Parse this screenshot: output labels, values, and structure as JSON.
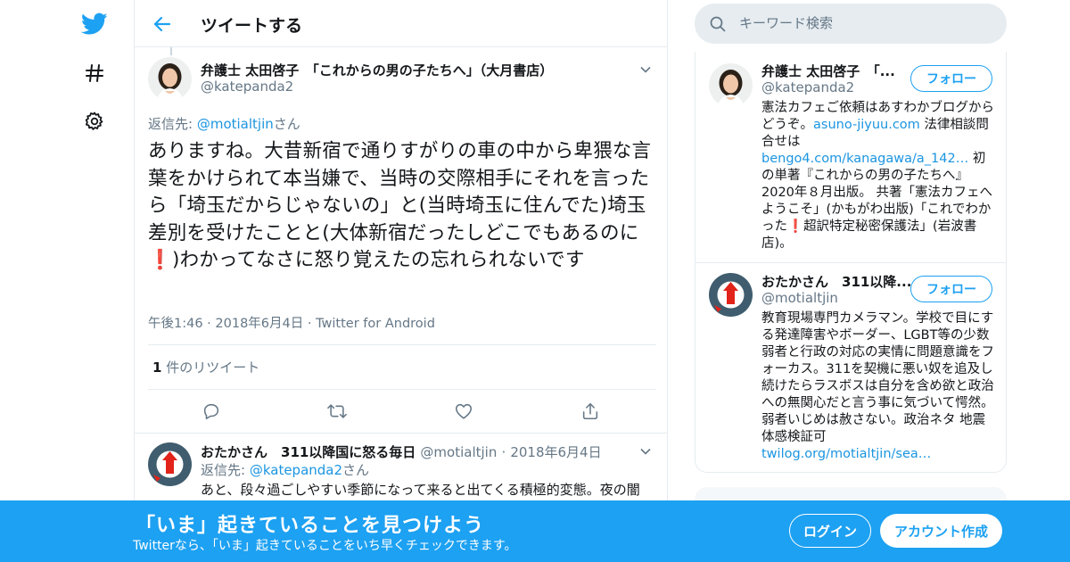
{
  "header": {
    "title": "ツイートする"
  },
  "tweet": {
    "author_name": "弁護士 太田啓子　「これからの男の子たちへ」（大月書店）",
    "author_handle": "@katepanda2",
    "reply_prefix": "返信先: ",
    "reply_to": "@motialtjin",
    "reply_suffix": "さん",
    "body_before_emoji": "ありますね。大昔新宿で通りすがりの車の中から卑猥な言葉をかけられて本当嫌で、当時の交際相手にそれを言ったら「埼玉だからじゃないの」と(当時埼玉に住んでた)埼玉差別を受けたことと(大体新宿だったしどこでもあるのに",
    "emoji": "❗",
    "body_after_emoji": ")わかってなさに怒り覚えたの忘れられないです",
    "time": "午後1:46",
    "date": "2018年6月4日",
    "source": "Twitter for Android",
    "separator": "·",
    "retweet_count": "1",
    "retweet_label": "件のリツイート"
  },
  "reply": {
    "author_name": "おたかさん　311以降国に怒る毎日",
    "author_handle": "@motialtjin",
    "separator": "·",
    "date": "2018年6月4日",
    "reply_prefix": "返信先: ",
    "reply_to": "@katepanda2",
    "reply_suffix": "さん",
    "body": "あと、段々過ごしやすい季節になって来ると出てくる積極的変態。夜の闇"
  },
  "search": {
    "placeholder": "キーワード検索"
  },
  "users": [
    {
      "name": "弁護士 太田啓子　「...",
      "handle": "@katepanda2",
      "follow_label": "フォロー",
      "bio_1": "憲法カフェご依頼はあすわかブログからどうぞ。",
      "bio_link_1": "asuno-jiyuu.com",
      "bio_2": " 法律相談問合せは",
      "bio_link_2": "bengo4.com/kanagawa/a_142…",
      "bio_3": " 初の単著『これからの男の子たちへ』2020年８月出版。 共著「憲法カフェへようこそ」(かもがわ出版)「これでわかった",
      "bio_emoji": "❗",
      "bio_4": "超訳特定秘密保護法」(岩波書店)。"
    },
    {
      "name": "おたかさん　311以降...",
      "handle": "@motialtjin",
      "follow_label": "フォロー",
      "bio": "教育現場専門カメラマン。学校で目にする発達障害やボーダー、LGBT等の少数弱者と行政の対応の実情に問題意識をフォーカス。311を契機に悪い奴を追及し続けたらラスボスは自分を含め欲と政治への無関心だと言う事に気づいて愕然。弱者いじめは赦さない。政治ネタ 地震体感検証可",
      "bio_link": "twilog.org/motialtjin/sea…"
    }
  ],
  "banner": {
    "title": "「いま」起きていることを見つけよう",
    "subtitle": "Twitterなら、「いま」起きていることをいち早くチェックできます。",
    "login_label": "ログイン",
    "signup_label": "アカウント作成"
  },
  "colors": {
    "accent": "#1da1f2",
    "link": "#1b95e0",
    "muted": "#657786",
    "border": "#e6ecf0"
  },
  "icons": [
    "twitter-bird-icon",
    "hashtag-icon",
    "gear-icon",
    "back-arrow-icon",
    "chevron-down-icon",
    "reply-icon",
    "retweet-icon",
    "like-icon",
    "share-icon",
    "search-icon"
  ]
}
